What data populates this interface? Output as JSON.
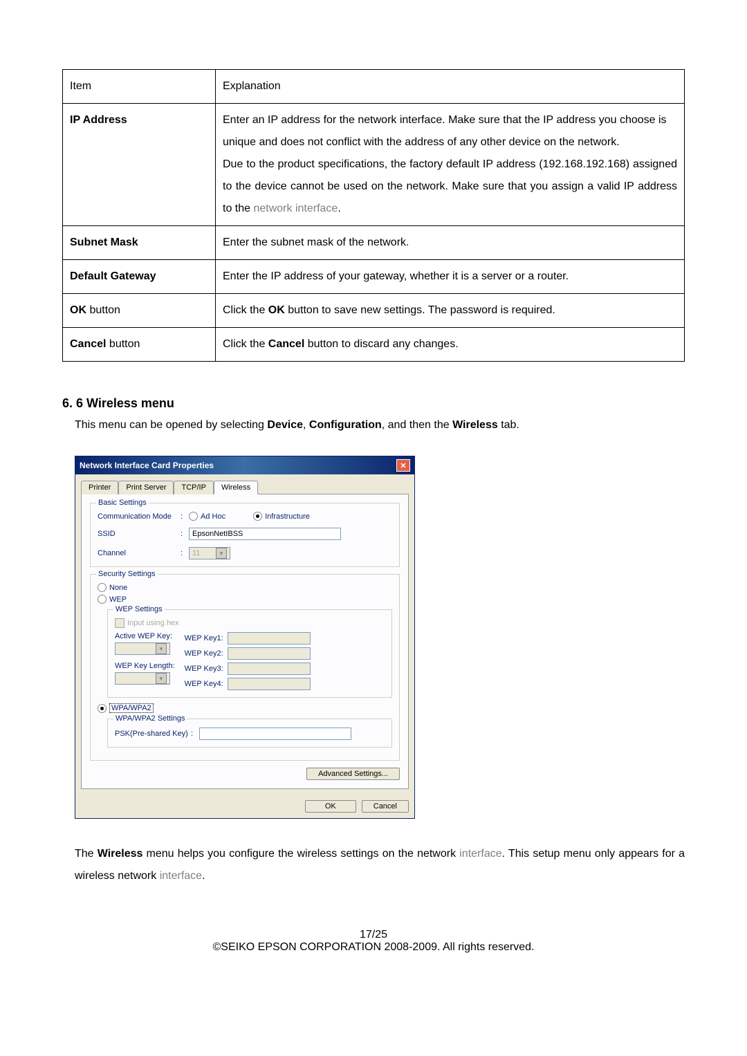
{
  "table": {
    "header": {
      "item": "Item",
      "explanation": "Explanation"
    },
    "rows": [
      {
        "item": "IP Address",
        "text1": "Enter an IP address for the network interface. Make sure that the IP address you choose is unique and does not conflict with the address of any other device on the network.",
        "text2": "Due to the product specifications, the factory default IP address (192.168.192.168) assigned to the device cannot be used on the network. Make sure that you assign a valid IP address to the ",
        "text2_grey": "network interface",
        "text2_end": "."
      },
      {
        "item": "Subnet Mask",
        "text": "Enter the subnet mask of the network."
      },
      {
        "item": "Default Gateway",
        "text": "Enter the IP address of your gateway, whether it is a server or a router."
      },
      {
        "item_bold": "OK",
        "item_rest": " button",
        "text_pre": "Click the ",
        "text_bold": "OK",
        "text_post": " button to save new settings. The password is required."
      },
      {
        "item_bold": "Cancel",
        "item_rest": " button",
        "text_pre": "Click the ",
        "text_bold": "Cancel",
        "text_post": " button to discard any changes."
      }
    ]
  },
  "section": {
    "heading": "6. 6 Wireless menu",
    "intro_pre": "This menu can be opened by selecting ",
    "intro_b1": "Device",
    "intro_sep1": ", ",
    "intro_b2": "Configuration",
    "intro_sep2": ", and then the ",
    "intro_b3": "Wireless",
    "intro_end": " tab."
  },
  "dialog": {
    "title": "Network Interface Card Properties",
    "close": "✕",
    "tabs": {
      "printer": "Printer",
      "printserver": "Print Server",
      "tcpip": "TCP/IP",
      "wireless": "Wireless"
    },
    "basic": {
      "legend": "Basic Settings",
      "comm_mode": "Communication Mode",
      "adhoc": "Ad Hoc",
      "infrastructure": "Infrastructure",
      "ssid": "SSID",
      "ssid_value": "EpsonNetIBSS",
      "channel": "Channel",
      "channel_value": "11"
    },
    "security": {
      "legend": "Security Settings",
      "none": "None",
      "wep": "WEP",
      "wep_settings": "WEP Settings",
      "input_hex": "Input using hex",
      "active_wep": "Active WEP Key:",
      "wep_length": "WEP Key Length:",
      "key1": "WEP Key1:",
      "key2": "WEP Key2:",
      "key3": "WEP Key3:",
      "key4": "WEP Key4:",
      "wpa": "WPA/WPA2",
      "wpa_settings": "WPA/WPA2 Settings",
      "psk": "PSK(Pre-shared Key)"
    },
    "advanced": "Advanced Settings...",
    "ok": "OK",
    "cancel": "Cancel"
  },
  "description": {
    "pre": "The ",
    "bold": "Wireless",
    "mid": " menu helps you configure the wireless settings on the network ",
    "grey1": "interface",
    "mid2": ". This setup menu only appears for a wireless network ",
    "grey2": "interface",
    "end": "."
  },
  "footer": {
    "page": "17/25",
    "copyright": "©SEIKO EPSON CORPORATION 2008-2009. All rights reserved."
  }
}
